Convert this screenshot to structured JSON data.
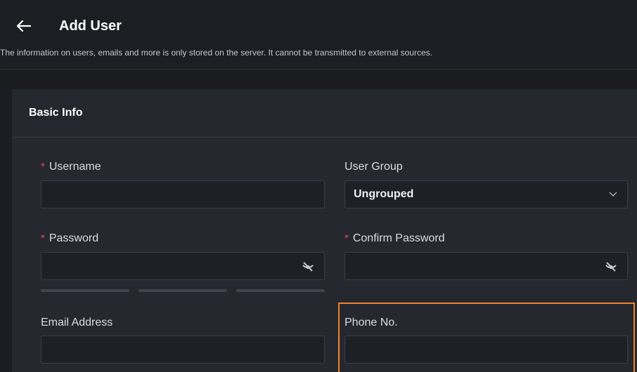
{
  "header": {
    "back_icon": "arrow-left-icon",
    "title": "Add User",
    "info": "The information on users, emails and more is only stored on the server. It cannot be transmitted to external sources."
  },
  "section": {
    "title": "Basic Info"
  },
  "form": {
    "required_marker": "*",
    "username": {
      "label": "Username",
      "value": ""
    },
    "user_group": {
      "label": "User Group",
      "value": "Ungrouped"
    },
    "password": {
      "label": "Password",
      "value": "",
      "icon": "eye-off-icon"
    },
    "confirm_password": {
      "label": "Confirm Password",
      "value": "",
      "icon": "eye-off-icon"
    },
    "email": {
      "label": "Email Address",
      "value": ""
    },
    "phone": {
      "label": "Phone No.",
      "value": ""
    }
  },
  "colors": {
    "background": "#1b1d22",
    "panel": "#25282e",
    "required": "#e2495f",
    "highlight": "#f0842c"
  }
}
